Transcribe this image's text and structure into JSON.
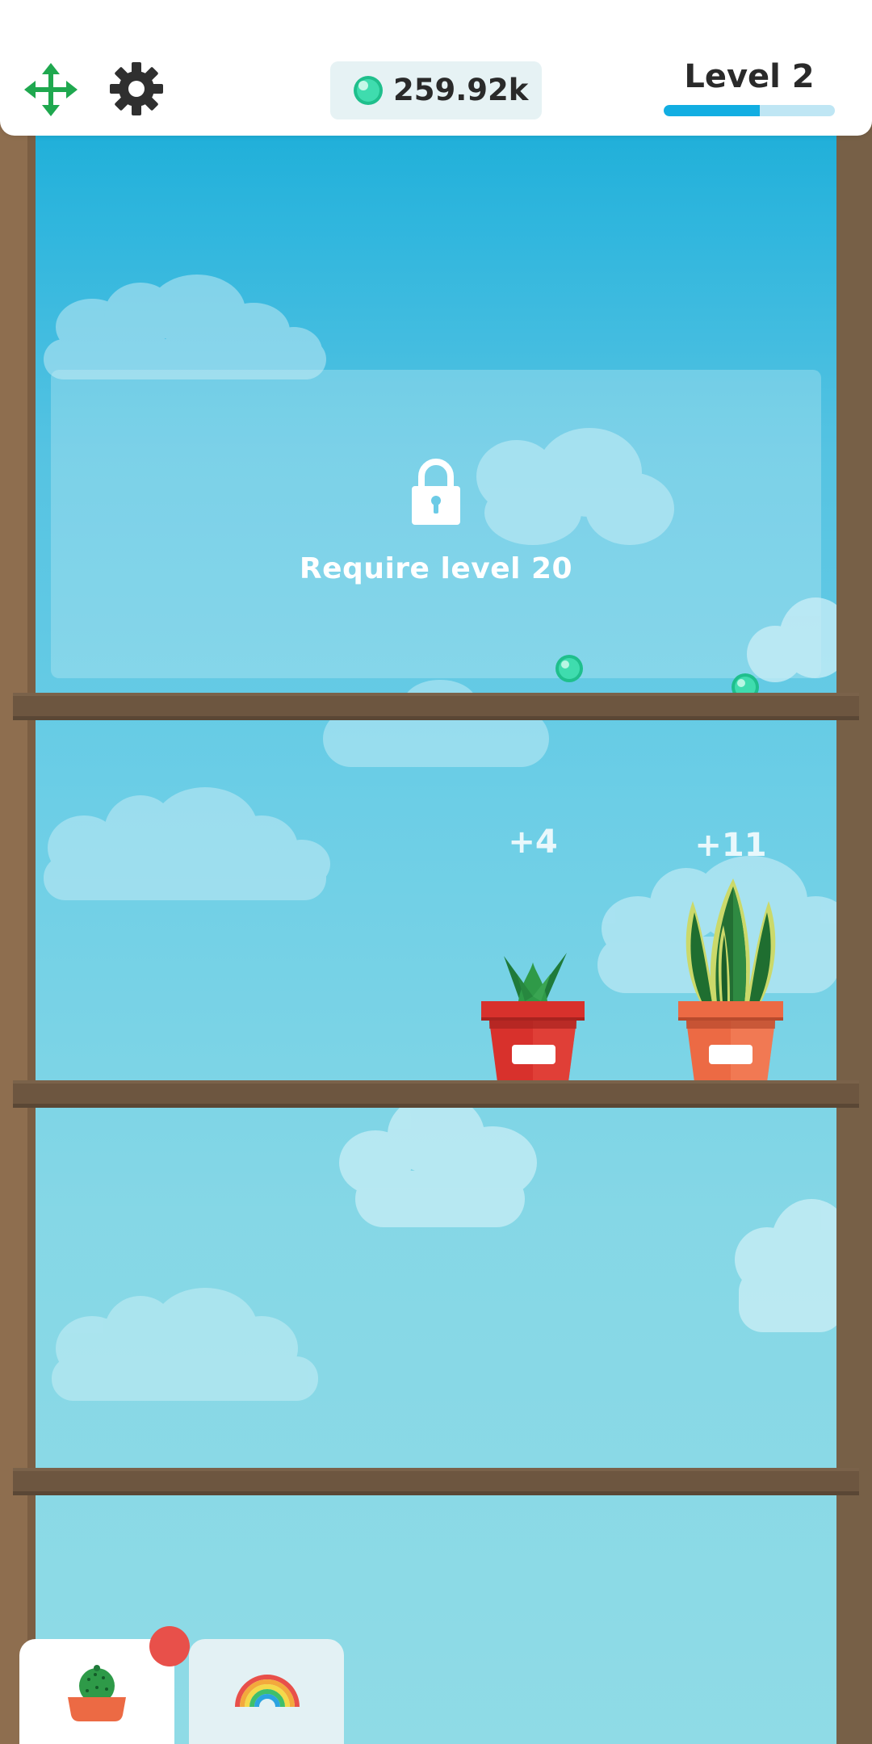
{
  "header": {
    "currency_value": "259.92k",
    "currency_icon": "green-gem-icon",
    "level_label": "Level 2",
    "level_progress": 0.56
  },
  "shelves": [
    {
      "locked": true,
      "lock_text": "Require level 20",
      "lock_icon": "lock-icon"
    },
    {
      "locked": false,
      "plants": [
        {
          "type": "aloe",
          "pot_color": "#d8312c",
          "earn_label": "+4"
        },
        {
          "type": "snake-plant",
          "pot_color": "#ec6a44",
          "earn_label": "+11"
        }
      ]
    },
    {
      "locked": false,
      "plants": []
    },
    {
      "locked": false,
      "plants": []
    }
  ],
  "bottom_tabs": [
    {
      "icon": "cactus-pot-icon",
      "active": true,
      "has_notification": true
    },
    {
      "icon": "rainbow-icon",
      "active": false,
      "has_notification": false
    }
  ],
  "colors": {
    "accent": "#12aee2",
    "gem": "#2fd3a2",
    "frame_wood": "#8e6e4f",
    "shelf_wood": "#6d5640",
    "notification": "#e8504a"
  }
}
